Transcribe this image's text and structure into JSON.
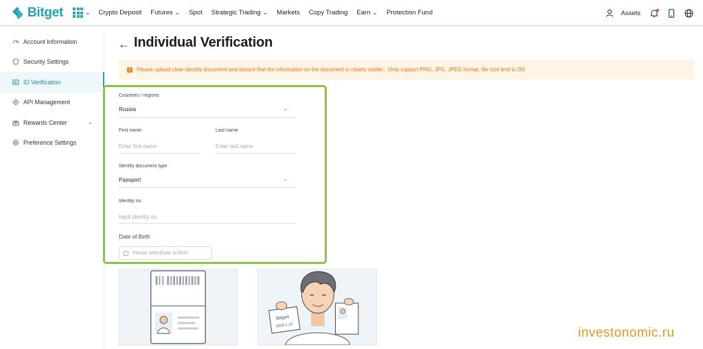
{
  "brand": {
    "name": "Bitget",
    "color": "#1fa1b1"
  },
  "nav": {
    "items": [
      {
        "label": "Crypto Deposit",
        "dropdown": false
      },
      {
        "label": "Futures",
        "dropdown": true
      },
      {
        "label": "Spot",
        "dropdown": false
      },
      {
        "label": "Strategic Trading",
        "dropdown": true
      },
      {
        "label": "Markets",
        "dropdown": false
      },
      {
        "label": "Copy Trading",
        "dropdown": false
      },
      {
        "label": "Earn",
        "dropdown": true
      },
      {
        "label": "Protection Fund",
        "dropdown": false
      }
    ],
    "assets_label": "Assets"
  },
  "sidebar": {
    "items": [
      {
        "label": "Account Information",
        "icon": "speedometer-icon",
        "active": false
      },
      {
        "label": "Security Settings",
        "icon": "shield-icon",
        "active": false
      },
      {
        "label": "ID Verification",
        "icon": "id-card-icon",
        "active": true
      },
      {
        "label": "API Management",
        "icon": "api-icon",
        "active": false
      },
      {
        "label": "Rewards Center",
        "icon": "gift-icon",
        "active": false,
        "expandable": true
      },
      {
        "label": "Preference Settings",
        "icon": "gear-icon",
        "active": false
      }
    ]
  },
  "page": {
    "title": "Individual Verification",
    "notice": "Please upload clear identity document and ensure that the information on the document is clearly visible：Only support PNG, JPG, JPEG format, file size limit is 2M",
    "notice_color": "#e0761b",
    "highlight_color": "#8bc34a"
  },
  "form": {
    "country": {
      "label": "Countries / regions",
      "value": "Russia"
    },
    "first_name": {
      "label": "First name",
      "placeholder": "Enter first name"
    },
    "last_name": {
      "label": "Last name",
      "placeholder": "Enter last name"
    },
    "doc_type": {
      "label": "Identity document type",
      "value": "Passport"
    },
    "id_no": {
      "label": "Identity no.",
      "placeholder": "Input identity no."
    },
    "dob": {
      "label": "Date of Birth",
      "placeholder": "Please selectDate of Birth"
    }
  },
  "samples": {
    "selfie_card_text": "bitget",
    "selfie_card_date": "2020.1.23"
  },
  "watermark": "investonomic.ru"
}
